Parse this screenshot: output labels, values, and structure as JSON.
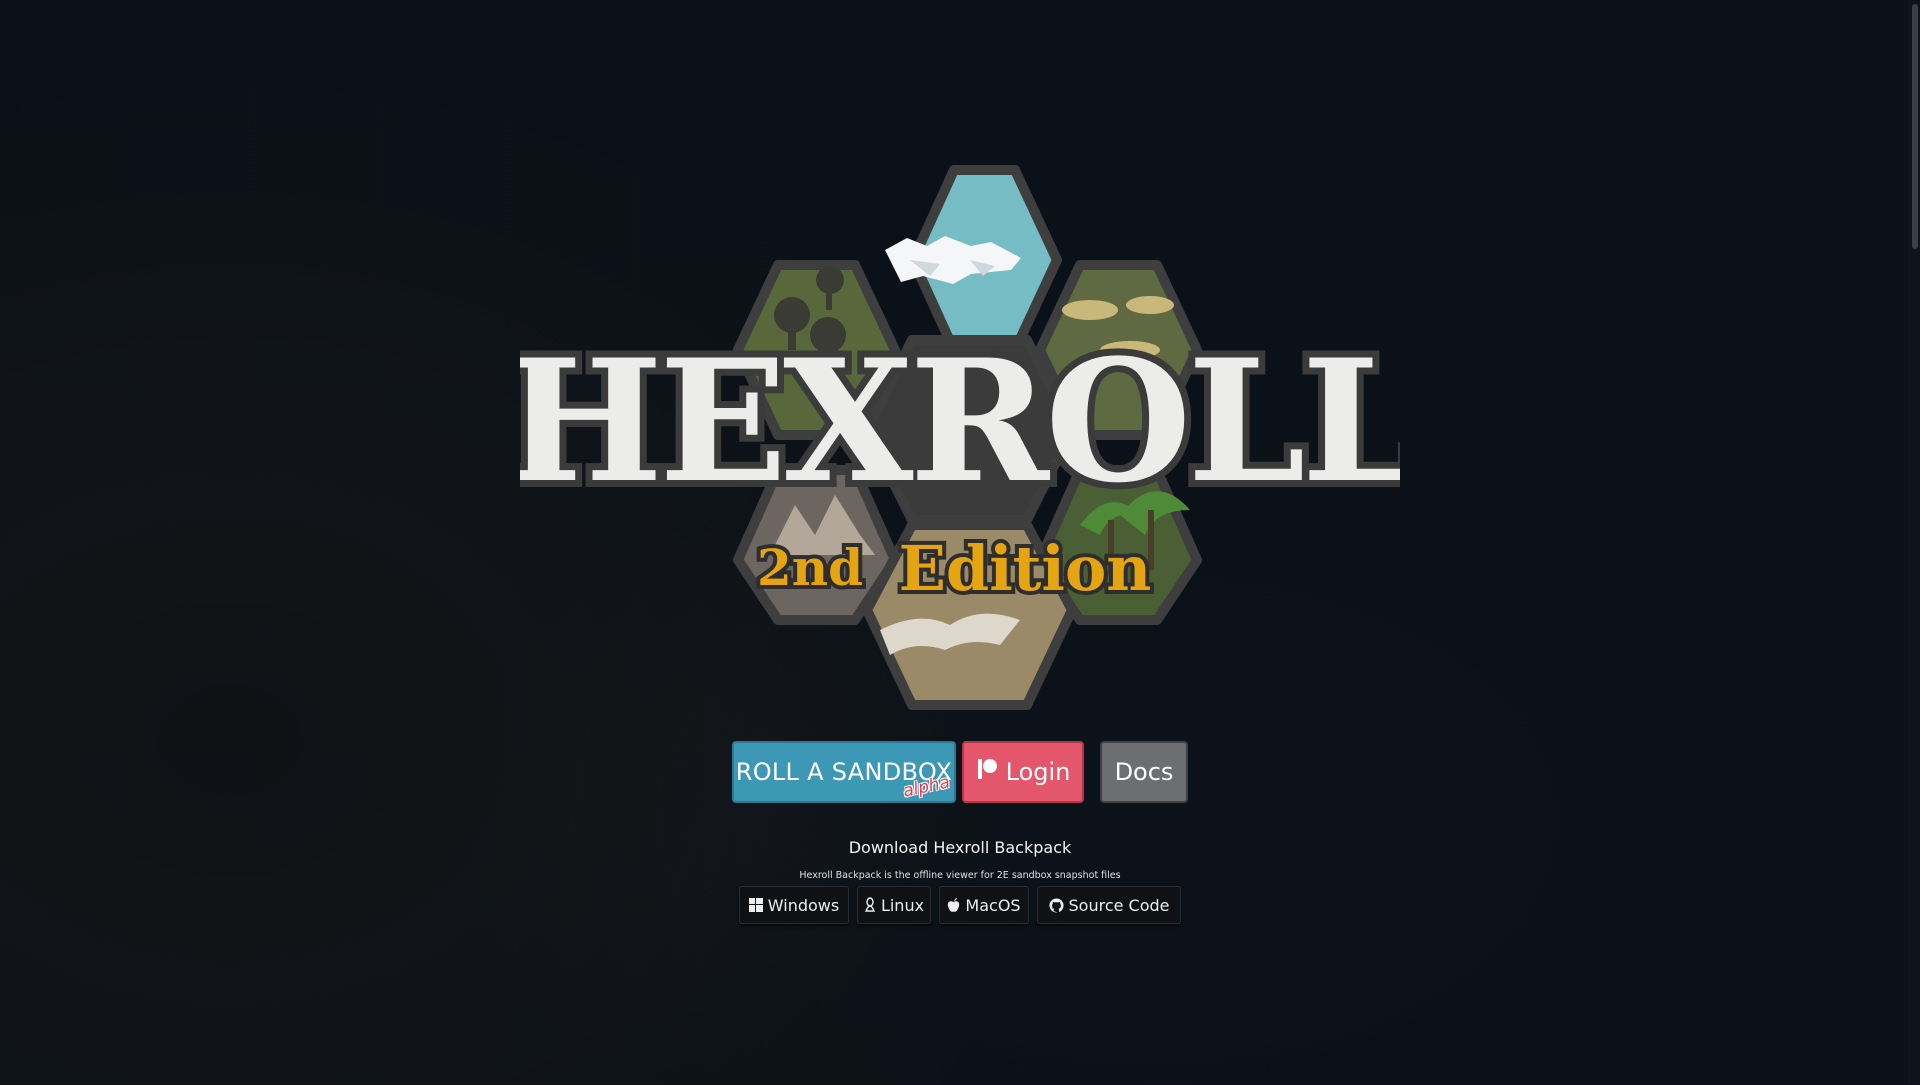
{
  "logo": {
    "title": "HEXROLL",
    "edition_number": "2nd",
    "edition_word": "Edition"
  },
  "actions": {
    "roll_label": "ROLL A SANDBOX",
    "roll_tag": "alpha",
    "login_label": "Login",
    "login_icon": "patreon-icon",
    "docs_label": "Docs"
  },
  "download": {
    "title": "Download Hexroll Backpack",
    "subtitle": "Hexroll Backpack is the offline viewer for 2E sandbox snapshot files",
    "buttons": [
      {
        "label": "Windows",
        "icon": "windows-icon"
      },
      {
        "label": "Linux",
        "icon": "linux-icon"
      },
      {
        "label": "MacOS",
        "icon": "apple-icon"
      },
      {
        "label": "Source Code",
        "icon": "github-icon"
      }
    ]
  },
  "colors": {
    "roll_button": "#3d98b6",
    "login_button": "#e4566b",
    "docs_button": "#6d6e6f",
    "edition_gold": "#e5a412"
  }
}
